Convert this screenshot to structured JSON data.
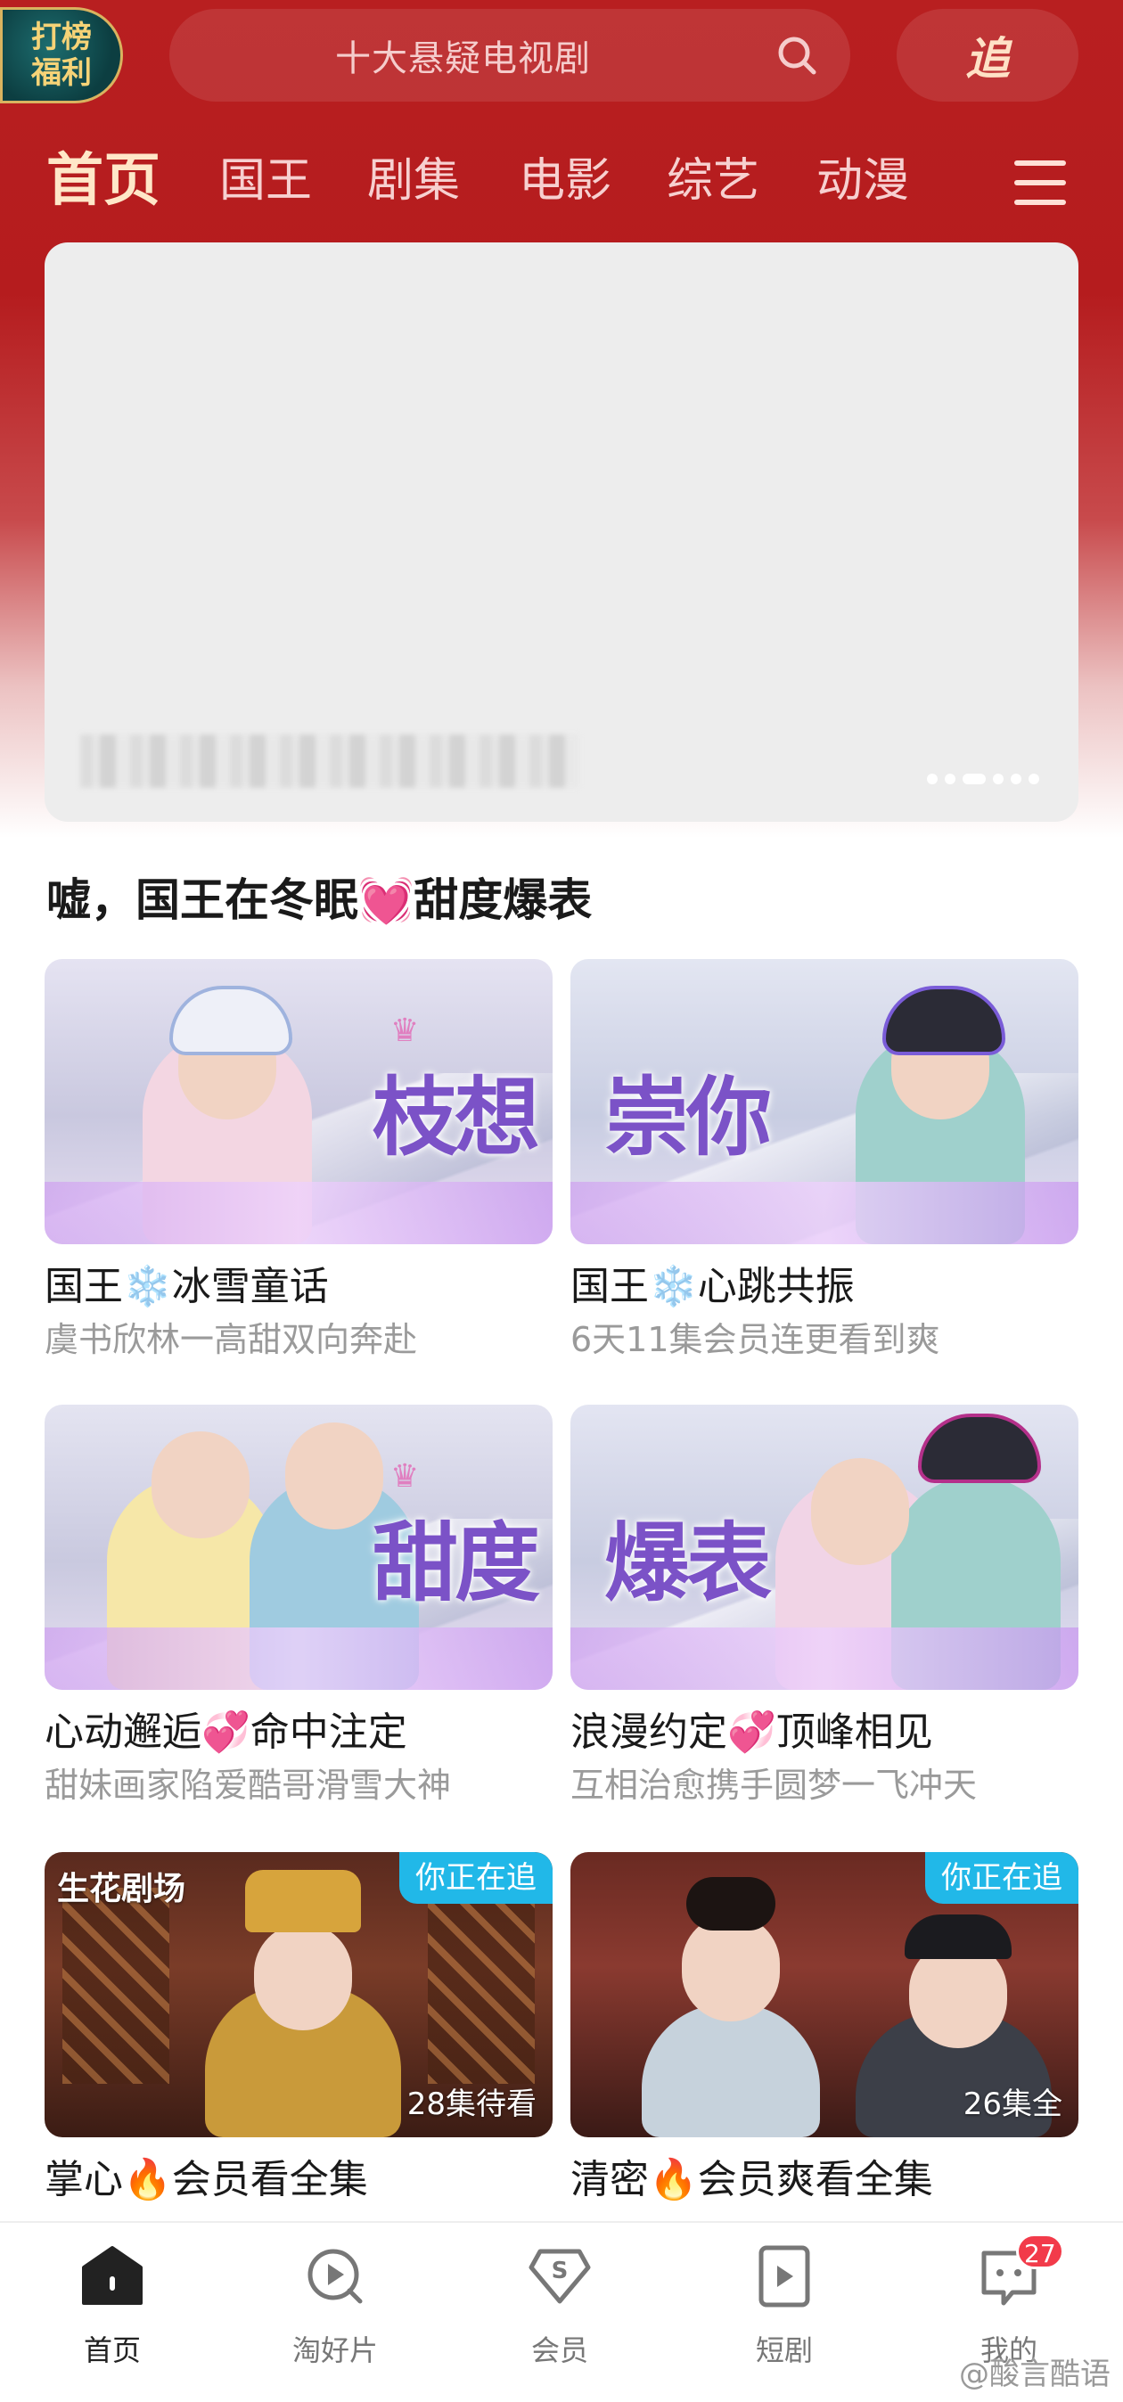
{
  "header": {
    "badge_line1": "打榜",
    "badge_line2": "福利",
    "search_placeholder": "十大悬疑电视剧",
    "search_icon": "search-icon",
    "follow_icon": "follow-icon",
    "follow_label": "追"
  },
  "nav": {
    "tabs": [
      {
        "label": "首页",
        "active": true
      },
      {
        "label": "国王",
        "active": false
      },
      {
        "label": "剧集",
        "active": false
      },
      {
        "label": "电影",
        "active": false
      },
      {
        "label": "综艺",
        "active": false
      },
      {
        "label": "动漫",
        "active": false
      }
    ],
    "menu_icon": "menu-icon"
  },
  "banner": {
    "slide_count": 6,
    "active_slide": 3
  },
  "section": {
    "title": "嘘，国王在冬眠💓甜度爆表",
    "cards": [
      {
        "thumb_title": "枝想",
        "title": "国王❄️冰雪童话",
        "subtitle": "虞书欣林一高甜双向奔赴"
      },
      {
        "thumb_title": "崇你",
        "title": "国王❄️心跳共振",
        "subtitle": "6天11集会员连更看到爽"
      },
      {
        "thumb_title": "甜度",
        "title": "心动邂逅💞命中注定",
        "subtitle": "甜妹画家陷爱酷哥滑雪大神"
      },
      {
        "thumb_title": "爆表",
        "title": "浪漫约定💞顶峰相见",
        "subtitle": "互相治愈携手圆梦一飞冲天"
      },
      {
        "logo": "生花剧场",
        "tag": "你正在追",
        "count": "28集待看",
        "title": "掌心🔥会员看全集"
      },
      {
        "tag": "你正在追",
        "count": "26集全",
        "title": "清密🔥会员爽看全集"
      }
    ]
  },
  "tabbar": {
    "items": [
      {
        "label": "首页",
        "icon": "home-icon",
        "active": true
      },
      {
        "label": "淘好片",
        "icon": "discover-icon",
        "active": false
      },
      {
        "label": "会员",
        "icon": "vip-icon",
        "active": false
      },
      {
        "label": "短剧",
        "icon": "short-drama-icon",
        "active": false
      },
      {
        "label": "我的",
        "icon": "profile-icon",
        "active": false,
        "badge": "27"
      }
    ]
  },
  "watermark": "@酸言酷语",
  "colors": {
    "brand_red": "#b81f20",
    "tag_blue": "#21b8e8",
    "badge_red": "#f23b4a"
  }
}
